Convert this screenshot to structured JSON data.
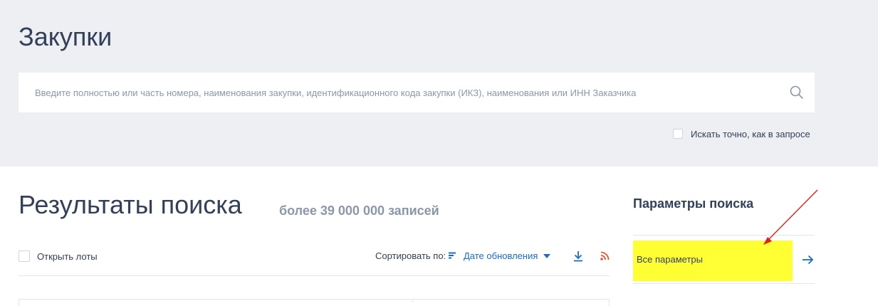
{
  "header": {
    "title": "Закупки"
  },
  "search": {
    "placeholder": "Введите полностью или часть номера, наименования закупки, идентификационного кода закупки (ИКЗ), наименования или ИНН Заказчика",
    "value": "",
    "icon": "search-icon",
    "exact_match_label": "Искать точно, как в запросе",
    "exact_match_checked": false
  },
  "results": {
    "title": "Результаты поиска",
    "count_text": "более 39 000 000 записей",
    "open_lots_label": "Открыть лоты",
    "open_lots_checked": false,
    "sort_label": "Сортировать по:",
    "sort_value": "Дате обновления",
    "icons": [
      "sort-icon",
      "chevron-down-icon",
      "download-icon",
      "rss-icon"
    ]
  },
  "params": {
    "title": "Параметры поиска",
    "all_params_label": "Все параметры",
    "highlight_color": "#ffff33",
    "annotation_arrow_color": "#e0201a"
  },
  "colors": {
    "accent": "#1a6bd1",
    "text": "#334059",
    "muted": "#8a97ab",
    "band": "#eeeff2",
    "rss": "#e8542f"
  }
}
